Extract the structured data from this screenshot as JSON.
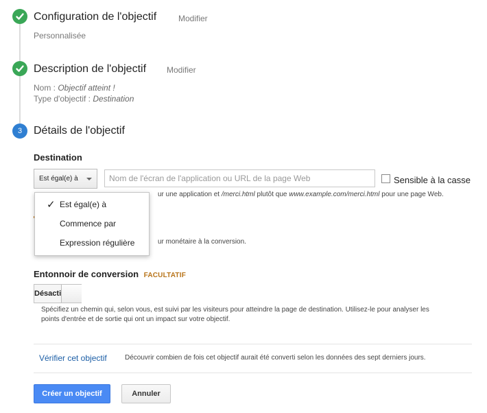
{
  "steps": {
    "step1": {
      "title": "Configuration de l'objectif",
      "modify": "Modifier",
      "summary": "Personnalisée"
    },
    "step2": {
      "title": "Description de l'objectif",
      "modify": "Modifier",
      "name_label": "Nom : ",
      "name_value": "Objectif atteint !",
      "type_label": "Type d'objectif : ",
      "type_value": "Destination"
    },
    "step3": {
      "number": "3",
      "title": "Détails de l'objectif"
    }
  },
  "destination": {
    "label": "Destination",
    "match_type_selected": "Est égal(e) à",
    "url_placeholder": "Nom de l'écran de l'application ou URL de la page Web",
    "case_sensitive_label": "Sensible à la casse",
    "hint_prefix": "ur une application et ",
    "hint_example1": "/merci.html",
    "hint_mid": " plutôt que ",
    "hint_example2": "www.example.com/merci.html",
    "hint_suffix": " pour une page Web.",
    "dropdown_options": [
      "Est égal(e) à",
      "Commence par",
      "Expression régulière"
    ],
    "dropdown_checkmark": "✓"
  },
  "value": {
    "hint_fragment": "ur monétaire à la conversion."
  },
  "funnel": {
    "label": "Entonnoir de conversion",
    "optional_tag": "FACULTATIF",
    "toggle_label": "Désacti",
    "description_line1": "Spécifiez un chemin qui, selon vous, est suivi par les visiteurs pour atteindre la page de destination. Utilisez-le pour analyser les",
    "description_line2": "points d'entrée et de sortie qui ont un impact sur votre objectif."
  },
  "verify": {
    "link": "Vérifier cet objectif",
    "description": "Découvrir combien de fois cet objectif aurait été converti selon les données des sept derniers jours."
  },
  "actions": {
    "create": "Créer un objectif",
    "cancel": "Annuler"
  },
  "colors": {
    "check_green": "#3aa757",
    "step_blue": "#2f7fd2",
    "primary_button": "#4a8af4",
    "optional_orange": "#b8741a",
    "link_blue": "#1a5da5"
  }
}
